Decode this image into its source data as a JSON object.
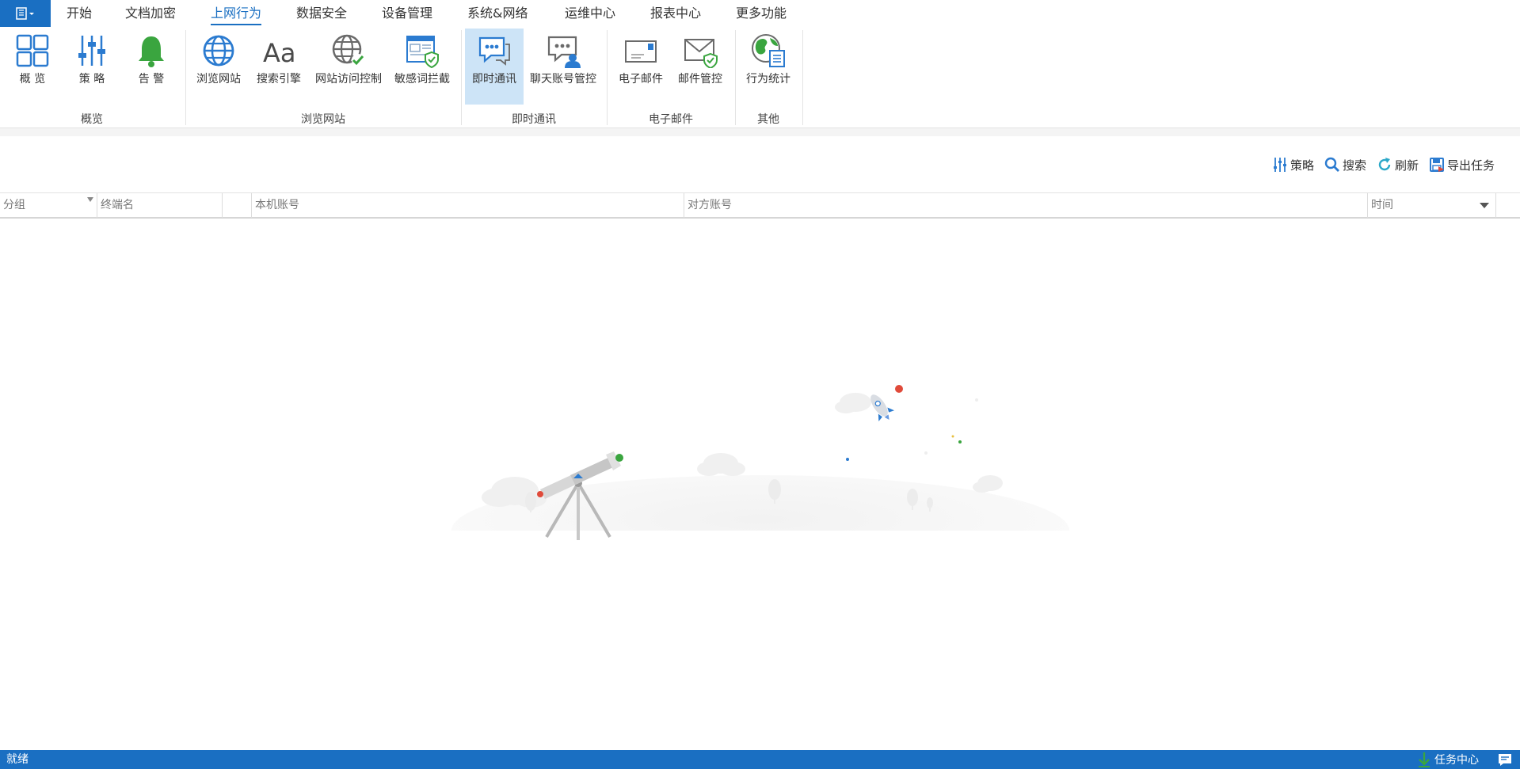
{
  "menu": {
    "tabs": [
      {
        "label": "开始"
      },
      {
        "label": "文档加密"
      },
      {
        "label": "上网行为"
      },
      {
        "label": "数据安全"
      },
      {
        "label": "设备管理"
      },
      {
        "label": "系统&网络"
      },
      {
        "label": "运维中心"
      },
      {
        "label": "报表中心"
      },
      {
        "label": "更多功能"
      }
    ],
    "active_tab": "上网行为"
  },
  "ribbon": {
    "buttons": {
      "overview": "概 览",
      "policy": "策 略",
      "alert": "告 警",
      "browse_web": "浏览网站",
      "search_engine": "搜索引擎",
      "web_access_control": "网站访问控制",
      "sensitive_word_block": "敏感词拦截",
      "instant_messaging": "即时通讯",
      "chat_account_control": "聊天账号管控",
      "email": "电子邮件",
      "email_control": "邮件管控",
      "behavior_stats": "行为统计"
    },
    "groups": {
      "overview": "概览",
      "browse_web": "浏览网站",
      "instant_messaging": "即时通讯",
      "email": "电子邮件",
      "other": "其他"
    },
    "selected_button": "即时通讯"
  },
  "toolbar": {
    "policy": "策略",
    "search": "搜索",
    "refresh": "刷新",
    "export": "导出任务"
  },
  "table": {
    "columns": [
      "分组",
      "终端名",
      "",
      "本机账号",
      "对方账号",
      "时间"
    ]
  },
  "status": {
    "text": "就绪",
    "task_center": "任务中心"
  },
  "colors": {
    "accent": "#1a6fc2",
    "selected_bg": "#cde4f7",
    "status_bar": "#1a6fc2"
  },
  "icons": [
    "app-menu-icon",
    "overview-grid-icon",
    "policy-sliders-icon",
    "bell-icon",
    "globe-icon",
    "font-aa-icon",
    "globe-check-icon",
    "browser-shield-icon",
    "chat-bubbles-icon",
    "chat-person-icon",
    "envelope-icon",
    "envelope-check-icon",
    "earth-document-icon",
    "refresh-icon",
    "search-icon",
    "save-icon",
    "download-arrow-icon",
    "message-icon"
  ]
}
